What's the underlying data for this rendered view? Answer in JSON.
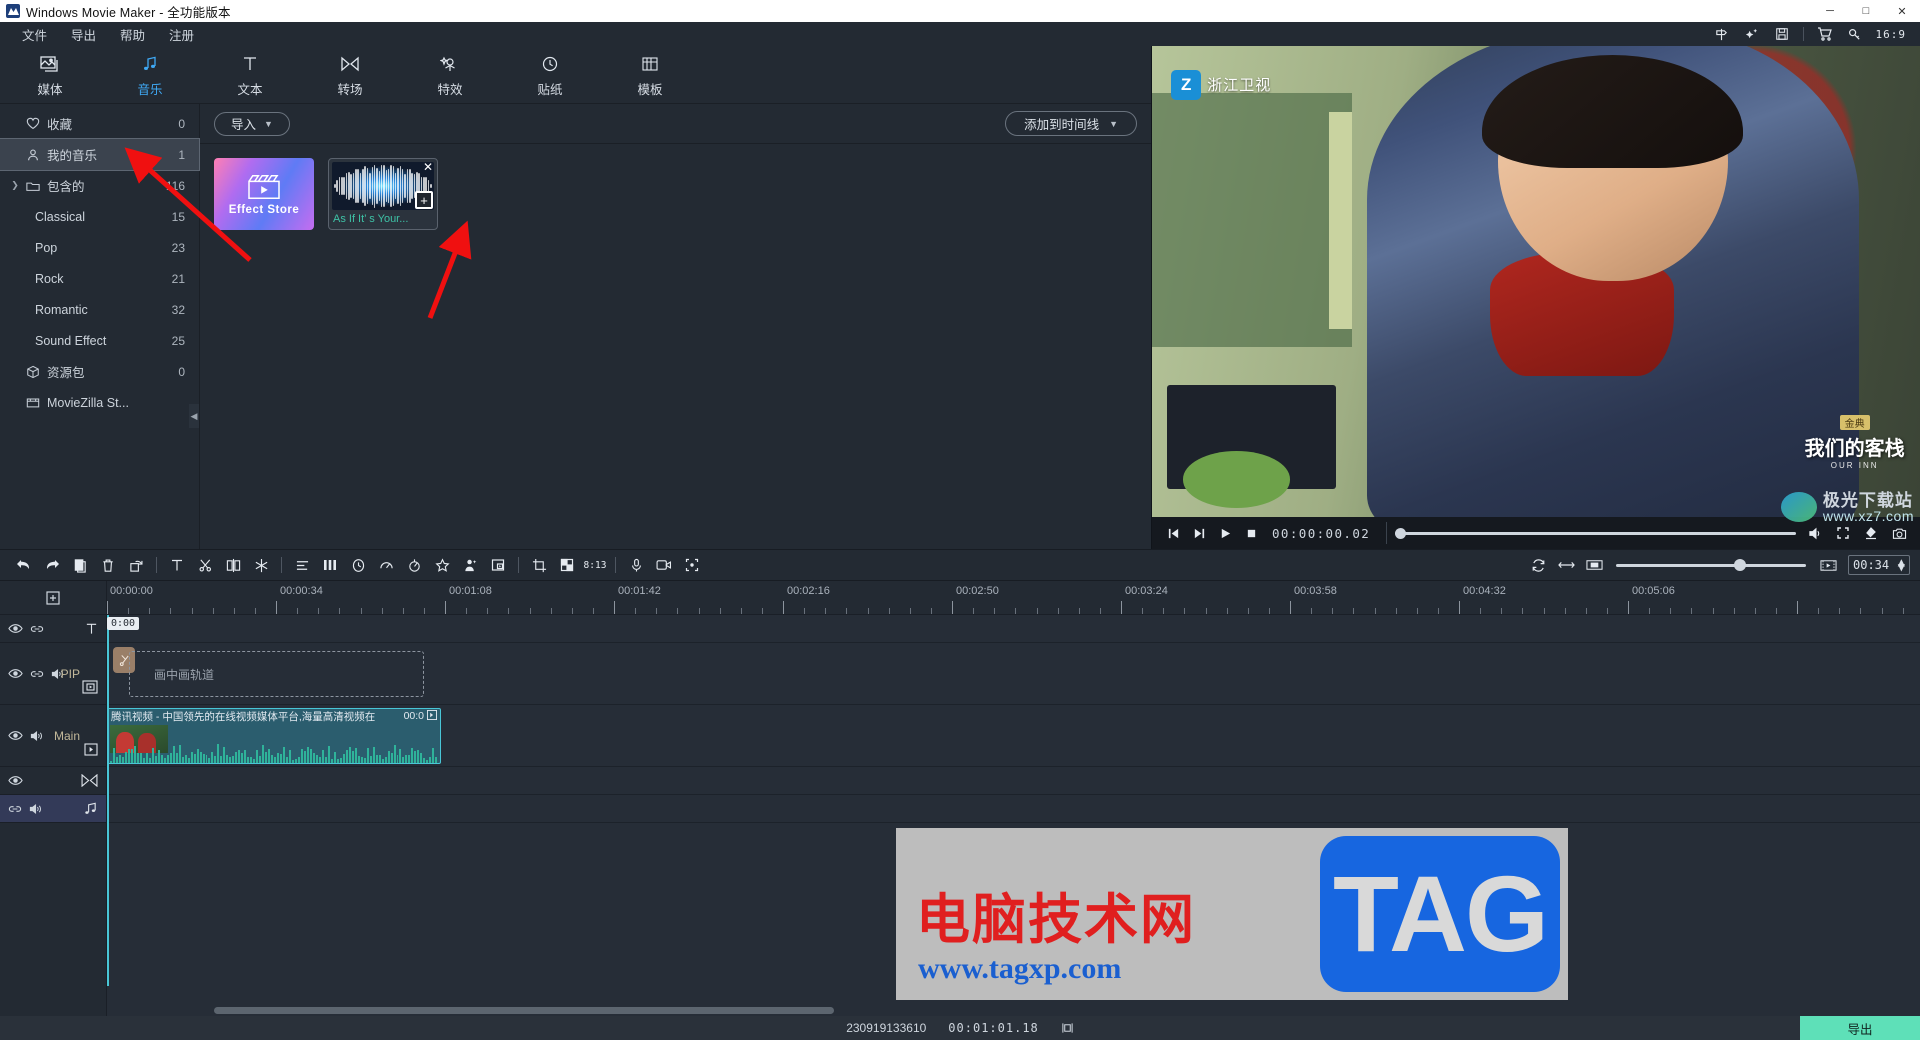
{
  "window": {
    "title": "Windows Movie Maker  - 全功能版本",
    "logo_icon": "movie-maker-logo-icon",
    "minimize": "─",
    "maximize": "□",
    "close": "✕"
  },
  "menubar": {
    "items": [
      {
        "label": "文件",
        "name": "menu-file"
      },
      {
        "label": "导出",
        "name": "menu-export"
      },
      {
        "label": "帮助",
        "name": "menu-help"
      },
      {
        "label": "注册",
        "name": "menu-register"
      }
    ],
    "right_icons": [
      "signpost-icon",
      "magic-star-icon",
      "save-icon",
      "cart-icon",
      "key-icon"
    ],
    "aspect_ratio": "16:9"
  },
  "ribbon": {
    "tabs": [
      {
        "label": "媒体",
        "icon": "media-icon",
        "active": false
      },
      {
        "label": "音乐",
        "icon": "music-note-icon",
        "active": true
      },
      {
        "label": "文本",
        "icon": "text-t-icon",
        "active": false
      },
      {
        "label": "转场",
        "icon": "transition-icon",
        "active": false
      },
      {
        "label": "特效",
        "icon": "effects-icon",
        "active": false
      },
      {
        "label": "贴纸",
        "icon": "sticker-clock-icon",
        "active": false
      },
      {
        "label": "模板",
        "icon": "template-grid-icon",
        "active": false
      }
    ]
  },
  "tree": {
    "items": [
      {
        "label": "收藏",
        "count": "0",
        "icon": "heart-icon",
        "indent": 0,
        "selected": false,
        "expandable": false
      },
      {
        "label": "我的音乐",
        "count": "1",
        "icon": "person-icon",
        "indent": 0,
        "selected": true,
        "expandable": false
      },
      {
        "label": "包含的",
        "count": "116",
        "icon": "folder-icon",
        "indent": 0,
        "selected": false,
        "expandable": true
      },
      {
        "label": "Classical",
        "count": "15",
        "icon": "",
        "indent": 1,
        "selected": false,
        "expandable": false
      },
      {
        "label": "Pop",
        "count": "23",
        "icon": "",
        "indent": 1,
        "selected": false,
        "expandable": false
      },
      {
        "label": "Rock",
        "count": "21",
        "icon": "",
        "indent": 1,
        "selected": false,
        "expandable": false
      },
      {
        "label": "Romantic",
        "count": "32",
        "icon": "",
        "indent": 1,
        "selected": false,
        "expandable": false
      },
      {
        "label": "Sound Effect",
        "count": "25",
        "icon": "",
        "indent": 1,
        "selected": false,
        "expandable": false
      },
      {
        "label": "资源包",
        "count": "0",
        "icon": "package-icon",
        "indent": 0,
        "selected": false,
        "expandable": false
      },
      {
        "label": "MovieZilla St...",
        "count": "",
        "icon": "store-icon",
        "indent": 0,
        "selected": false,
        "expandable": false
      }
    ],
    "collapse_handle": "◀"
  },
  "browser": {
    "import_label": "导入",
    "add_to_timeline_label": "添加到时间线",
    "tiles": [
      {
        "type": "store",
        "label": "Effect Store",
        "name": "effect-store-tile"
      },
      {
        "type": "audio",
        "label": "As If It’ s Your...",
        "name": "audio-clip-tile",
        "close": "✕",
        "add": "+"
      }
    ]
  },
  "preview": {
    "channel_logo_text": "浙江卫视",
    "channel_logo_mark": "Z",
    "show_badge": "金典",
    "show_title": "我们的客栈",
    "show_sub": "OUR INN",
    "controls": {
      "prev": "prev-frame-icon",
      "next": "next-frame-icon",
      "play": "play-icon",
      "stop": "stop-icon",
      "timecode": "00:00:00.02",
      "volume": "volume-icon",
      "fullscreen": "fullscreen-icon",
      "color": "color-picker-icon",
      "snapshot": "camera-icon"
    }
  },
  "toolbar": {
    "icons": [
      "undo-icon",
      "redo-icon",
      "copy-icon",
      "delete-icon",
      "rotate-icon",
      "sep",
      "text-icon",
      "scissors-icon",
      "split-icon",
      "freeze-icon",
      "sep",
      "align-icon",
      "columns-icon",
      "clock-icon",
      "speed-icon",
      "mask-icon",
      "star-icon",
      "person-mask-icon",
      "pip-icon",
      "sep",
      "crop-icon",
      "pip-overlay-icon",
      "ratio-8-13-icon",
      "sep",
      "mic-icon",
      "record-icon",
      "fit-icon"
    ],
    "ratio_label": "8:13",
    "right": {
      "refresh_icon": "refresh-icon",
      "fit_icon": "fit-horizontal-icon",
      "zoom_out_icon": "zoom-out-clip-icon",
      "zoom_in_icon": "zoom-in-clip-icon",
      "duration": "00:34"
    }
  },
  "timeline": {
    "add_track_icon": "add-track-icon",
    "playhead_label": "0:00",
    "ruler_labels": [
      "00:00:00",
      "00:00:34",
      "00:01:08",
      "00:01:42",
      "00:02:16",
      "00:02:50",
      "00:03:24",
      "00:03:58",
      "00:04:32",
      "00:05:06"
    ],
    "tracks": [
      {
        "name": "text-track",
        "label": "",
        "type_icon": "text-t-icon",
        "eye": true,
        "link": true,
        "speaker": false
      },
      {
        "name": "pip-track",
        "label": "PIP",
        "type_icon": "pip-icon",
        "eye": true,
        "link": true,
        "speaker": true
      },
      {
        "name": "main-track",
        "label": "Main",
        "type_icon": "video-icon",
        "eye": true,
        "link": false,
        "speaker": true
      },
      {
        "name": "transition-track",
        "label": "",
        "type_icon": "transition-icon",
        "eye": true,
        "link": false,
        "speaker": false
      },
      {
        "name": "audio-track",
        "label": "",
        "type_icon": "music-note-icon",
        "eye": false,
        "link": true,
        "speaker": true
      }
    ],
    "pip_placeholder": "画中画轨道",
    "main_clip": {
      "title": "腾讯视频 - 中国领先的在线视频媒体平台,海量高清视频在",
      "duration": "00:0",
      "expand_icon": "expand-clip-icon"
    }
  },
  "statusbar": {
    "project_id": "230919133610",
    "timecode": "00:01:01.18",
    "frame_icon": "frame-icon",
    "export_label": "导出"
  },
  "watermark": {
    "cn_text": "电脑技术网",
    "url": "www.tagxp.com",
    "tag": "TAG"
  },
  "overlay_watermark": {
    "title": "极光下载站",
    "url": "www.xz7.com"
  },
  "colors": {
    "accent": "#3fa9f5",
    "playhead": "#49c6d6",
    "clip": "#2b5d6e",
    "export": "#5ee0b8",
    "annotation": "#f01010"
  }
}
